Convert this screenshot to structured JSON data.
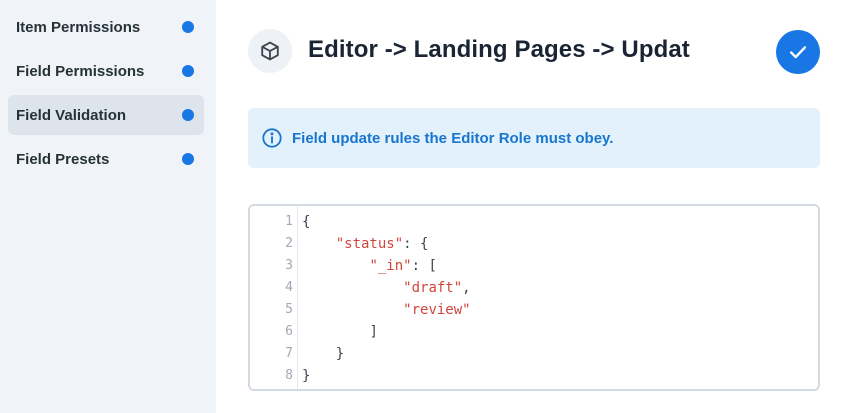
{
  "sidebar": {
    "items": [
      {
        "label": "Item Permissions",
        "active": false
      },
      {
        "label": "Field Permissions",
        "active": false
      },
      {
        "label": "Field Validation",
        "active": true
      },
      {
        "label": "Field Presets",
        "active": false
      }
    ]
  },
  "header": {
    "icon": "cube-icon",
    "title": "Editor -> Landing Pages -> Updat",
    "save_icon": "check-icon"
  },
  "notice": {
    "icon": "info-icon",
    "text": "Field update rules the Editor Role must obey."
  },
  "editor": {
    "line_numbers": [
      "1",
      "2",
      "3",
      "4",
      "5",
      "6",
      "7",
      "8"
    ],
    "lines": [
      {
        "indent": "",
        "key": "",
        "value": "",
        "punct": "{"
      },
      {
        "indent": "    ",
        "key": "\"status\"",
        "value": "",
        "punct": ": {"
      },
      {
        "indent": "        ",
        "key": "\"_in\"",
        "value": "",
        "punct": ": ["
      },
      {
        "indent": "            ",
        "key": "",
        "value": "\"draft\"",
        "punct": ","
      },
      {
        "indent": "            ",
        "key": "",
        "value": "\"review\"",
        "punct": ""
      },
      {
        "indent": "        ",
        "key": "",
        "value": "",
        "punct": "]"
      },
      {
        "indent": "    ",
        "key": "",
        "value": "",
        "punct": "}"
      },
      {
        "indent": "",
        "key": "",
        "value": "",
        "punct": "}"
      }
    ]
  },
  "colors": {
    "accent": "#1877e5",
    "dot": "#1877e5",
    "string": "#d0463c",
    "info": "#1876cf"
  }
}
